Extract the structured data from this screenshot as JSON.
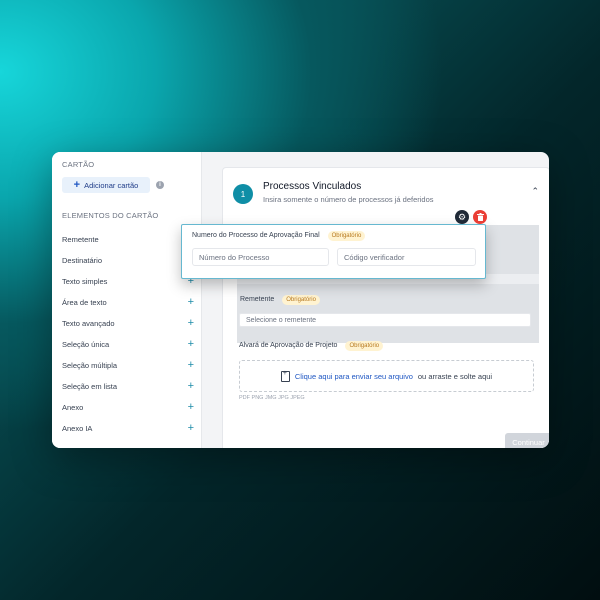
{
  "sidebar": {
    "card_section": "CARTÃO",
    "add_card_label": "Adicionar cartão",
    "elements_section": "ELEMENTOS DO CARTÃO",
    "items": [
      {
        "label": "Remetente"
      },
      {
        "label": "Destinatário"
      },
      {
        "label": "Texto simples"
      },
      {
        "label": "Área de texto"
      },
      {
        "label": "Texto avançado"
      },
      {
        "label": "Seleção única"
      },
      {
        "label": "Seleção múltipla"
      },
      {
        "label": "Seleção em lista"
      },
      {
        "label": "Anexo"
      },
      {
        "label": "Anexo IA"
      }
    ]
  },
  "step": {
    "number": "1",
    "title": "Processos Vinculados",
    "subtitle": "Insira somente o número de processos já deferidos"
  },
  "form": {
    "remetente_label": "Remetente",
    "remetente_badge": "Obrigatório",
    "remetente_placeholder": "Selecione o remetente",
    "alvara_label": "Alvará de Aprovação de Projeto",
    "alvara_badge": "Obrigatório",
    "upload_link": "Clique aqui para enviar seu arquivo",
    "upload_rest": "ou arraste e solte aqui",
    "formats": "PDF PNG JMG JPG JPEG",
    "continue_label": "Continuar"
  },
  "floating_card": {
    "label": "Numero do Processo de Aprovação Final",
    "badge": "Obrigatório",
    "process_placeholder": "Número do Processo",
    "code_placeholder": "Código verificador"
  },
  "colors": {
    "accent": "#0f8ea6",
    "delete": "#ea3e35",
    "badge_bg": "#fff3d1"
  }
}
